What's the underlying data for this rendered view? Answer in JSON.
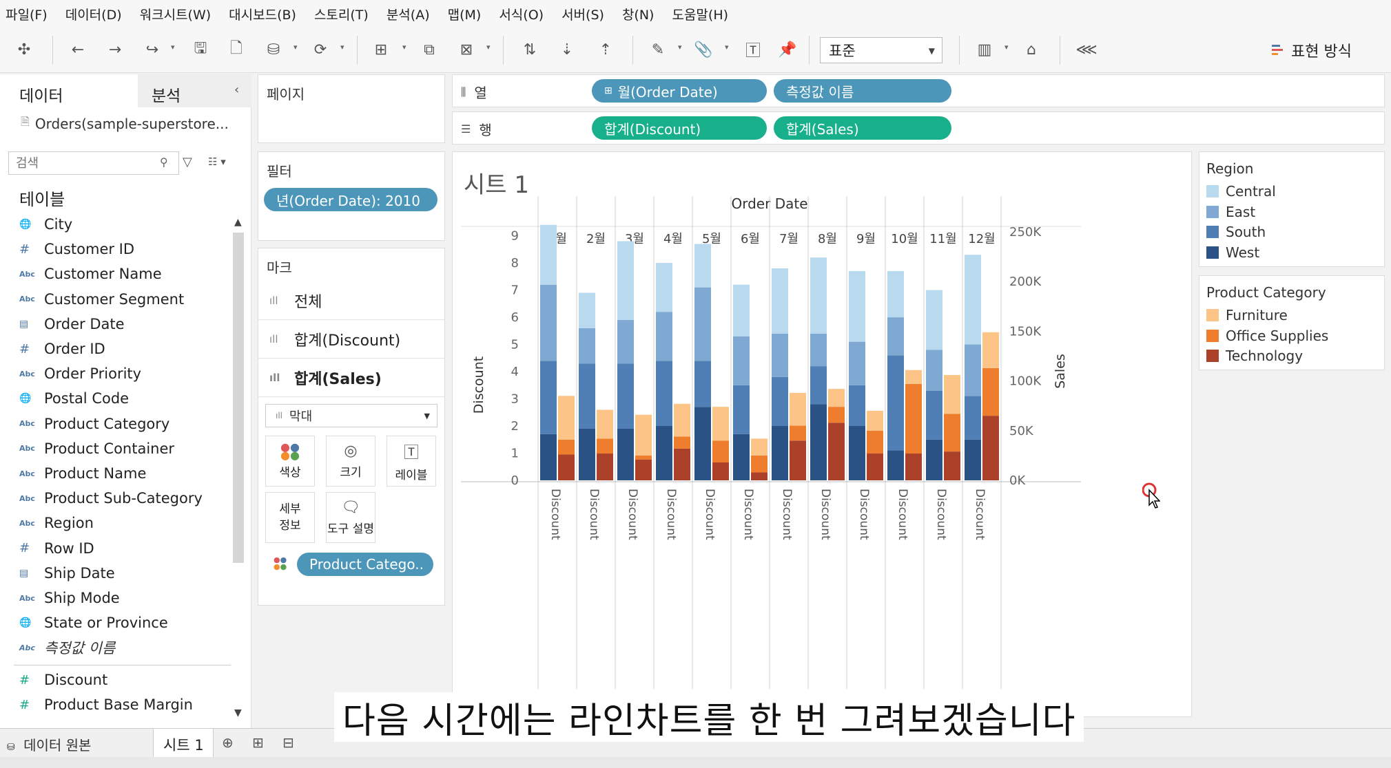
{
  "menu": [
    "파일(F)",
    "데이터(D)",
    "워크시트(W)",
    "대시보드(B)",
    "스토리(T)",
    "분석(A)",
    "맵(M)",
    "서식(O)",
    "서버(S)",
    "창(N)",
    "도움말(H)"
  ],
  "toolbar": {
    "fit_value": "표준",
    "show_me_label": "표현 방식"
  },
  "data_pane": {
    "tab_data": "데이터",
    "tab_analysis": "분석",
    "datasource": "Orders(sample-superstore...",
    "search_placeholder": "검색",
    "tables_label": "테이블",
    "dimensions": [
      {
        "icon": "globe",
        "name": "City"
      },
      {
        "icon": "hash",
        "name": "Customer ID"
      },
      {
        "icon": "abc",
        "name": "Customer Name"
      },
      {
        "icon": "abc",
        "name": "Customer Segment"
      },
      {
        "icon": "calendar",
        "name": "Order Date"
      },
      {
        "icon": "hash",
        "name": "Order ID"
      },
      {
        "icon": "abc",
        "name": "Order Priority"
      },
      {
        "icon": "globe",
        "name": "Postal Code"
      },
      {
        "icon": "abc",
        "name": "Product Category"
      },
      {
        "icon": "abc",
        "name": "Product Container"
      },
      {
        "icon": "abc",
        "name": "Product Name"
      },
      {
        "icon": "abc",
        "name": "Product Sub-Category"
      },
      {
        "icon": "abc",
        "name": "Region"
      },
      {
        "icon": "hash",
        "name": "Row ID"
      },
      {
        "icon": "calendar",
        "name": "Ship Date"
      },
      {
        "icon": "abc",
        "name": "Ship Mode"
      },
      {
        "icon": "globe",
        "name": "State or Province"
      },
      {
        "icon": "abc",
        "name": "측정값 이름"
      }
    ],
    "measures": [
      {
        "icon": "hash",
        "name": "Discount"
      },
      {
        "icon": "hash",
        "name": "Product Base Margin"
      }
    ]
  },
  "pages": {
    "title": "페이지"
  },
  "filters": {
    "title": "필터",
    "pill": "년(Order Date): 2010"
  },
  "marks": {
    "title": "마크",
    "rows": [
      "전체",
      "합계(Discount)",
      "합계(Sales)"
    ],
    "mark_type": "막대",
    "buttons": [
      "색상",
      "크기",
      "레이블",
      "세부 정보",
      "도구 설명"
    ],
    "color_pill": "Product Catego.."
  },
  "shelves": {
    "columns_label": "열",
    "rows_label": "행",
    "columns_pills": [
      "월(Order Date)",
      "측정값 이름"
    ],
    "rows_pills": [
      "합계(Discount)",
      "합계(Sales)"
    ]
  },
  "sheet": {
    "title": "시트 1"
  },
  "legends": {
    "region": {
      "title": "Region",
      "items": [
        {
          "name": "Central",
          "color": "#b9d9ef"
        },
        {
          "name": "East",
          "color": "#7fa9d3"
        },
        {
          "name": "South",
          "color": "#4f7fb4"
        },
        {
          "name": "West",
          "color": "#2b5285"
        }
      ]
    },
    "category": {
      "title": "Product Category",
      "items": [
        {
          "name": "Furniture",
          "color": "#fcc486"
        },
        {
          "name": "Office Supplies",
          "color": "#ef7d2e"
        },
        {
          "name": "Technology",
          "color": "#ab4128"
        }
      ]
    }
  },
  "chart_data": {
    "type": "bar",
    "top_header": "Order Date",
    "categories": [
      "1월",
      "2월",
      "3월",
      "4월",
      "5월",
      "6월",
      "7월",
      "8월",
      "9월",
      "10월",
      "11월",
      "12월"
    ],
    "bottom_label": "Discount",
    "left_axis": {
      "label": "Discount",
      "ticks": [
        0,
        1,
        2,
        3,
        4,
        5,
        6,
        7,
        8,
        9
      ],
      "range": [
        0,
        9.8
      ]
    },
    "right_axis": {
      "label": "Sales",
      "ticks": [
        "0K",
        "50K",
        "100K",
        "150K",
        "200K",
        "250K"
      ],
      "tick_values": [
        0,
        50000,
        100000,
        150000,
        200000,
        250000
      ],
      "range": [
        0,
        268000
      ]
    },
    "discount_series": [
      {
        "name": "West",
        "color": "#2b5285",
        "values": [
          1.7,
          1.9,
          1.9,
          2.0,
          2.7,
          1.7,
          2.0,
          2.8,
          2.0,
          1.1,
          1.5,
          1.5
        ]
      },
      {
        "name": "South",
        "color": "#4f7fb4",
        "values": [
          2.7,
          2.4,
          2.4,
          2.4,
          1.7,
          1.8,
          1.8,
          1.4,
          1.5,
          3.5,
          1.8,
          1.6
        ]
      },
      {
        "name": "East",
        "color": "#7fa9d3",
        "values": [
          2.8,
          1.3,
          1.6,
          1.8,
          2.7,
          1.8,
          1.6,
          1.2,
          1.6,
          1.4,
          1.5,
          1.9
        ]
      },
      {
        "name": "Central",
        "color": "#b9d9ef",
        "values": [
          2.2,
          1.3,
          2.9,
          1.8,
          1.6,
          1.9,
          2.4,
          2.8,
          2.6,
          1.7,
          2.2,
          3.3
        ]
      }
    ],
    "sales_series": [
      {
        "name": "Technology",
        "color": "#ab4128",
        "values": [
          26000,
          27000,
          21000,
          32000,
          18000,
          8000,
          40000,
          58000,
          27000,
          27000,
          29000,
          65000
        ]
      },
      {
        "name": "Office Supplies",
        "color": "#ef7d2e",
        "values": [
          15000,
          15000,
          4000,
          12000,
          22000,
          17000,
          15000,
          16000,
          23000,
          70000,
          38000,
          48000
        ]
      },
      {
        "name": "Furniture",
        "color": "#fcc486",
        "values": [
          44000,
          29000,
          41000,
          33000,
          34000,
          17000,
          33000,
          18000,
          20000,
          14000,
          39000,
          36000
        ]
      }
    ]
  },
  "tabs": {
    "datasource": "데이터 원본",
    "sheet": "시트 1"
  },
  "subtitle": "다음 시간에는 라인차트를 한 번 그려보겠습니다"
}
